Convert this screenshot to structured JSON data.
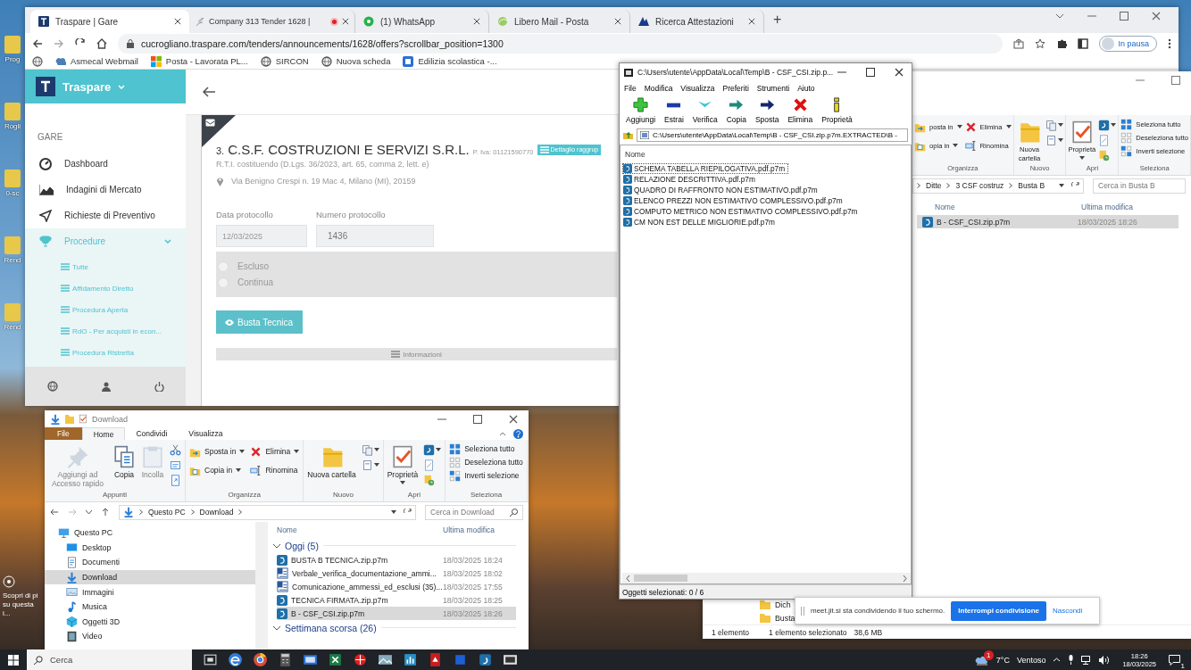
{
  "desktop": {
    "icons": [
      {
        "label": "Prog"
      },
      {
        "label": "Rogli"
      },
      {
        "label": "0-sc"
      },
      {
        "label": "Rend"
      },
      {
        "label": "Rend"
      }
    ],
    "spotlight": "Scopri di pi su questa i..."
  },
  "browser": {
    "tabs": [
      {
        "title": "Traspare | Gare",
        "selected": true,
        "recording": false
      },
      {
        "title": "Company 313 Tender 1628 |",
        "selected": false,
        "recording": true
      },
      {
        "title": "(1) WhatsApp",
        "selected": false,
        "recording": false
      },
      {
        "title": "Libero Mail - Posta",
        "selected": false,
        "recording": false
      },
      {
        "title": "Ricerca Attestazioni",
        "selected": false,
        "recording": false
      }
    ],
    "new_tab": "+",
    "url": "cucrogliano.traspare.com/tenders/announcements/1628/offers?scrollbar_position=1300",
    "profile": "In pausa",
    "bookmarks": [
      "Asmecal Webmail",
      "Posta - Lavorata PL...",
      "SIRCON",
      "Nuova scheda",
      "Edilizia scolastica -..."
    ]
  },
  "traspare": {
    "brand": "Traspare",
    "section": "GARE",
    "menu": [
      {
        "label": "Dashboard",
        "selected": false
      },
      {
        "label": "Indagini di Mercato",
        "selected": false
      },
      {
        "label": "Richieste di Preventivo",
        "selected": false
      },
      {
        "label": "Procedure",
        "selected": true,
        "children": [
          {
            "label": "Tutte"
          },
          {
            "label": "Affidamento Diretto"
          },
          {
            "label": "Procedura Aperta"
          },
          {
            "label": "RdO - Per acquisti in econ..."
          },
          {
            "label": "Procedura Ristretta"
          }
        ]
      }
    ],
    "card": {
      "number": "3.",
      "company": "C.S.F. COSTRUZIONI E SERVIZI S.R.L.",
      "vat": "P. Iva: 01121590770",
      "badge": "Dettaglio raggrup",
      "subtitle": "R.T.I. costituendo (D.Lgs. 36/2023, art. 65, comma 2, lett. e)",
      "address": "Via Benigno Crespi n. 19 Mac 4, Milano (MI), 20159",
      "fields": [
        {
          "label": "Data protocollo",
          "value": "12/03/2025"
        },
        {
          "label": "Numero protocollo",
          "value": "1436"
        }
      ],
      "options": [
        {
          "label": "Escluso",
          "selected": false
        },
        {
          "label": "Continua",
          "selected": false
        }
      ],
      "action": "Busta Tecnica",
      "info_bar": "Informazioni"
    }
  },
  "archive": {
    "title": "C:\\Users\\utente\\AppData\\Local\\Temp\\B - CSF_CSI.zip.p...",
    "menu": [
      "File",
      "Modifica",
      "Visualizza",
      "Preferiti",
      "Strumenti",
      "Aiuto"
    ],
    "toolbar": [
      "Aggiungi",
      "Estrai",
      "Verifica",
      "Copia",
      "Sposta",
      "Elimina",
      "Proprietà"
    ],
    "path": "C:\\Users\\utente\\AppData\\Local\\Temp\\B - CSF_CSI.zip.p7m.EXTRACTED\\B -",
    "column": "Nome",
    "files": [
      {
        "name": "SCHEMA TABELLA RIEPILOGATIVA.pdf.p7m",
        "focused": true
      },
      {
        "name": "RELAZIONE DESCRITTIVA.pdf.p7m",
        "focused": false
      },
      {
        "name": "QUADRO DI RAFFRONTO NON ESTIMATIVO.pdf.p7m",
        "focused": false
      },
      {
        "name": "ELENCO PREZZI NON ESTIMATIVO COMPLESSIVO.pdf.p7m",
        "focused": false
      },
      {
        "name": "COMPUTO METRICO NON ESTIMATIVO COMPLESSIVO.pdf.p7m",
        "focused": false
      },
      {
        "name": "CM NON EST DELLE MIGLIORIE.pdf.p7m",
        "focused": false
      }
    ],
    "status": "Oggetti selezionati: 0 / 6"
  },
  "busta": {
    "ribbon": [
      {
        "label": "Organizza",
        "columns": [
          [
            {
              "text": "posta in",
              "kind": "move",
              "dropdown": true,
              "disabled": false
            },
            {
              "text": "opia in",
              "kind": "copyto",
              "dropdown": true,
              "disabled": false
            }
          ],
          [
            {
              "text": "Elimina",
              "kind": "delete",
              "dropdown": true,
              "disabled": false
            },
            {
              "text": "Rinomina",
              "kind": "rename",
              "dropdown": false,
              "disabled": false
            }
          ]
        ]
      },
      {
        "label": "Nuovo",
        "columns": [
          [
            {
              "text": "Nuova cartella",
              "kind": "newfolder",
              "dropdown": false,
              "disabled": false
            }
          ],
          [
            {
              "kind": "newitem",
              "dropdown": true,
              "disabled": false
            },
            {
              "kind": "easyaccess",
              "dropdown": true,
              "disabled": false
            }
          ]
        ]
      },
      {
        "label": "Apri",
        "columns": [
          [
            {
              "text": "Proprietà",
              "kind": "properties",
              "dropdown": true,
              "disabled": false
            }
          ],
          [
            {
              "kind": "open",
              "dropdown": true,
              "disabled": false
            },
            {
              "kind": "edit",
              "dropdown": false,
              "disabled": false
            },
            {
              "kind": "history",
              "dropdown": false,
              "disabled": false
            }
          ]
        ]
      },
      {
        "label": "Seleziona",
        "columns": [
          [
            {
              "text": "Seleziona tutto",
              "kind": "selectall",
              "dropdown": false,
              "disabled": false
            },
            {
              "text": "Deseleziona tutto",
              "kind": "selectnone",
              "dropdown": false,
              "disabled": false
            },
            {
              "text": "Inverti selezione",
              "kind": "invert",
              "dropdown": false,
              "disabled": false
            }
          ]
        ]
      }
    ],
    "breadcrumb": [
      "Ditte",
      "3 CSF costruz",
      "Busta B"
    ],
    "search": {
      "placeholder": "Cerca in Busta B"
    },
    "columns": [
      "Nome",
      "Ultima modifica"
    ],
    "files": [
      {
        "name": "B - CSF_CSI.zip.p7m",
        "modified": "18/03/2025 18:26",
        "selected": true
      }
    ],
    "folders": [
      "Dich",
      "Busta"
    ],
    "status": [
      "1 elemento",
      "1 elemento selezionato",
      "38,6 MB"
    ]
  },
  "download": {
    "title": "Download",
    "tabs": [
      {
        "label": "File",
        "kind": "file",
        "selected": false
      },
      {
        "label": "Home",
        "kind": "tab",
        "selected": true
      },
      {
        "label": "Condividi",
        "kind": "tab",
        "selected": false
      },
      {
        "label": "Visualizza",
        "kind": "tab",
        "selected": false
      }
    ],
    "ribbon": [
      {
        "label": "Appunti",
        "columns": [
          [
            {
              "text": "Aggiungi ad Accesso rapido",
              "kind": "pin",
              "dropdown": false,
              "disabled": true
            }
          ],
          [
            {
              "text": "Copia",
              "kind": "copy",
              "dropdown": false,
              "disabled": false
            }
          ],
          [
            {
              "text": "Incolla",
              "kind": "paste",
              "dropdown": false,
              "disabled": true
            }
          ],
          [
            {
              "kind": "cut",
              "dropdown": false,
              "disabled": false
            },
            {
              "kind": "copypath",
              "dropdown": false,
              "disabled": false
            },
            {
              "kind": "shortcut",
              "dropdown": false,
              "disabled": false
            }
          ]
        ]
      },
      {
        "label": "Organizza",
        "columns": [
          [
            {
              "text": "Sposta in",
              "kind": "move",
              "dropdown": true,
              "disabled": false
            },
            {
              "text": "Copia in",
              "kind": "copyto",
              "dropdown": true,
              "disabled": false
            }
          ],
          [
            {
              "text": "Elimina",
              "kind": "delete",
              "dropdown": true,
              "disabled": false
            },
            {
              "text": "Rinomina",
              "kind": "rename",
              "dropdown": false,
              "disabled": false
            }
          ]
        ]
      },
      {
        "label": "Nuovo",
        "columns": [
          [
            {
              "text": "Nuova cartella",
              "kind": "newfolder",
              "dropdown": false,
              "disabled": false
            }
          ],
          [
            {
              "kind": "newitem",
              "dropdown": true,
              "disabled": false
            },
            {
              "kind": "easyaccess",
              "dropdown": true,
              "disabled": false
            }
          ]
        ]
      },
      {
        "label": "Apri",
        "columns": [
          [
            {
              "text": "Proprietà",
              "kind": "properties",
              "dropdown": true,
              "disabled": false
            }
          ],
          [
            {
              "kind": "open",
              "dropdown": true,
              "disabled": false
            },
            {
              "kind": "edit",
              "dropdown": false,
              "disabled": false
            },
            {
              "kind": "history",
              "dropdown": false,
              "disabled": false
            }
          ]
        ]
      },
      {
        "label": "Seleziona",
        "columns": [
          [
            {
              "text": "Seleziona tutto",
              "kind": "selectall",
              "dropdown": false,
              "disabled": false
            },
            {
              "text": "Deseleziona tutto",
              "kind": "selectnone",
              "dropdown": false,
              "disabled": false
            },
            {
              "text": "Inverti selezione",
              "kind": "invert",
              "dropdown": false,
              "disabled": false
            }
          ]
        ]
      }
    ],
    "breadcrumb": [
      "Questo PC",
      "Download"
    ],
    "search": {
      "placeholder": "Cerca in Download"
    },
    "nav": [
      {
        "label": "Questo PC",
        "kind": "pc",
        "selected": false,
        "children": [
          {
            "label": "Desktop",
            "kind": "desktop",
            "selected": false
          },
          {
            "label": "Documenti",
            "kind": "documents",
            "selected": false
          },
          {
            "label": "Download",
            "kind": "download",
            "selected": true
          },
          {
            "label": "Immagini",
            "kind": "pictures",
            "selected": false
          },
          {
            "label": "Musica",
            "kind": "music",
            "selected": false
          },
          {
            "label": "Oggetti 3D",
            "kind": "objects",
            "selected": false
          },
          {
            "label": "Video",
            "kind": "video",
            "selected": false
          }
        ]
      }
    ],
    "columns": [
      "Nome",
      "Ultima modifica"
    ],
    "groups": [
      {
        "label": "Oggi (5)",
        "expanded": true,
        "files": [
          {
            "name": "BUSTA B TECNICA.zip.p7m",
            "modified": "18/03/2025 18:24",
            "kind": "signed",
            "selected": false
          },
          {
            "name": "Verbale_verifica_documentazione_ammi...",
            "modified": "18/03/2025 18:02",
            "kind": "doc",
            "selected": false
          },
          {
            "name": "Comunicazione_ammessi_ed_esclusi (35)...",
            "modified": "18/03/2025 17:55",
            "kind": "doc",
            "selected": false
          },
          {
            "name": "TECNICA FIRMATA.zip.p7m",
            "modified": "18/03/2025 18:25",
            "kind": "signed",
            "selected": false
          },
          {
            "name": "B - CSF_CSI.zip.p7m",
            "modified": "18/03/2025 18:26",
            "kind": "signed",
            "selected": true
          }
        ]
      },
      {
        "label": "Settimana scorsa (26)",
        "expanded": true
      }
    ]
  },
  "share_bar": {
    "text": "meet.jit.si sta condividendo il tuo schermo.",
    "stop": "Interrompi condivisione",
    "hide": "Nascondi"
  },
  "taskbar": {
    "search": {
      "placeholder": "Cerca"
    },
    "weather_badge": "1",
    "temperature": "7°C",
    "weather": "Ventoso",
    "time": "18:26",
    "date": "18/03/2025",
    "notifications": "1"
  }
}
